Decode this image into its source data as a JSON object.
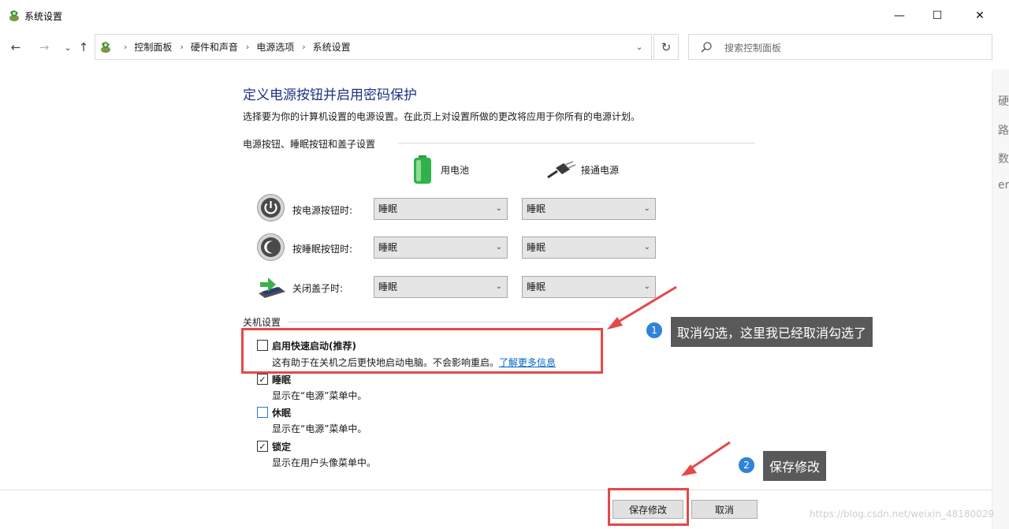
{
  "window": {
    "title": "系统设置"
  },
  "addressbar": {
    "crumbs": [
      "控制面板",
      "硬件和声音",
      "电源选项",
      "系统设置"
    ]
  },
  "search": {
    "placeholder": "搜索控制面板"
  },
  "right_pane": {
    "fragments": [
      "硬",
      "路",
      "数",
      "er"
    ]
  },
  "content": {
    "title": "定义电源按钮并启用密码保护",
    "description": "选择要为你的计算机设置的电源设置。在此页上对设置所做的更改将应用于你所有的电源计划。",
    "power_section": {
      "heading": "电源按钮、睡眠按钮和盖子设置",
      "col_battery": "用电池",
      "col_plugged": "接通电源",
      "rows": [
        {
          "label": "按电源按钮时:",
          "battery": "睡眠",
          "plugged": "睡眠"
        },
        {
          "label": "按睡眠按钮时:",
          "battery": "睡眠",
          "plugged": "睡眠"
        },
        {
          "label": "关闭盖子时:",
          "battery": "睡眠",
          "plugged": "睡眠"
        }
      ]
    },
    "shutdown_section": {
      "heading": "关机设置",
      "items": [
        {
          "title": "启用快速启动(推荐)",
          "desc": "这有助于在关机之后更快地启动电脑。不会影响重启。",
          "link": "了解更多信息",
          "checked": false
        },
        {
          "title": "睡眠",
          "desc": "显示在“电源”菜单中。",
          "checked": true
        },
        {
          "title": "休眠",
          "desc": "显示在“电源”菜单中。",
          "checked": false
        },
        {
          "title": "锁定",
          "desc": "显示在用户头像菜单中。",
          "checked": true
        }
      ]
    }
  },
  "buttons": {
    "save": "保存修改",
    "cancel": "取消"
  },
  "annotations": {
    "badge1": "1",
    "callout1": "取消勾选，这里我已经取消勾选了",
    "badge2": "2",
    "callout2": "保存修改",
    "highlight_color": "#e54848"
  },
  "watermark": "https://blog.csdn.net/weixin_48180029"
}
